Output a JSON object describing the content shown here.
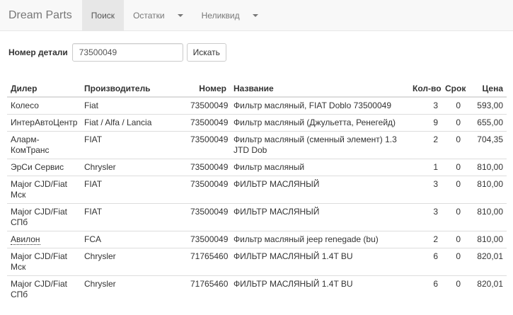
{
  "nav": {
    "brand": "Dream Parts",
    "items": [
      {
        "label": "Поиск",
        "active": true,
        "dropdown": false
      },
      {
        "label": "Остатки",
        "active": false,
        "dropdown": true
      },
      {
        "label": "Неликвид",
        "active": false,
        "dropdown": true
      }
    ]
  },
  "search": {
    "label": "Номер детали",
    "value": "73500049",
    "button": "Искать"
  },
  "table": {
    "headers": [
      "Дилер",
      "Производитель",
      "Номер",
      "Название",
      "Кол-во",
      "Срок",
      "Цена"
    ],
    "rows": [
      [
        "Колесо",
        "Fiat",
        "73500049",
        "Фильтр масляный, FIAT Doblo 73500049",
        "3",
        "0",
        "593,00"
      ],
      [
        "ИнтерАвтоЦентр",
        "Fiat / Alfa / Lancia",
        "73500049",
        "Фильтр масляный (Джульетта, Ренегейд)",
        "9",
        "0",
        "655,00"
      ],
      [
        "Аларм-КомТранс",
        "FIAT",
        "73500049",
        "Фильтр масляный (сменный элемент) 1.3 JTD Dob",
        "2",
        "0",
        "704,35"
      ],
      [
        "ЭрСи Сервис",
        "Chrysler",
        "73500049",
        "Фильтр масляный",
        "1",
        "0",
        "810,00"
      ],
      [
        "Major CJD/Fiat Мск",
        "FIAT",
        "73500049",
        "ФИЛЬТР МАСЛЯНЫЙ",
        "3",
        "0",
        "810,00"
      ],
      [
        "Major CJD/Fiat СПб",
        "FIAT",
        "73500049",
        "ФИЛЬТР МАСЛЯНЫЙ",
        "3",
        "0",
        "810,00"
      ],
      [
        "Авилон",
        "FCA",
        "73500049",
        "Фильтр масляный jeep renegade (bu)",
        "2",
        "0",
        "810,00"
      ],
      [
        "Major CJD/Fiat Мск",
        "Chrysler",
        "71765460",
        "ФИЛЬТР МАСЛЯНЫЙ 1.4T BU",
        "6",
        "0",
        "820,01"
      ],
      [
        "Major CJD/Fiat СПб",
        "Chrysler",
        "71765460",
        "ФИЛЬТР МАСЛЯНЫЙ 1.4T BU",
        "6",
        "0",
        "820,01"
      ]
    ],
    "dotted_dealer_rows": [
      6
    ]
  }
}
